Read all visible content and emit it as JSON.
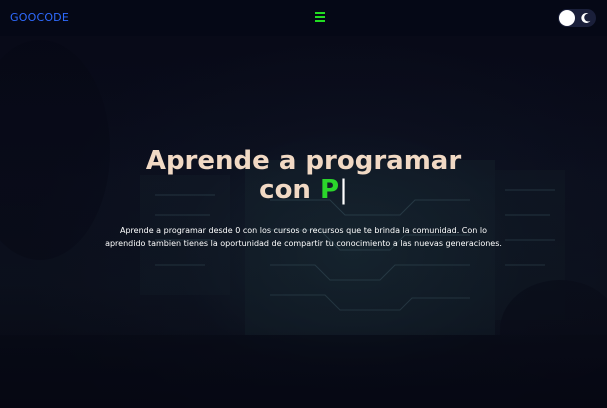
{
  "navbar": {
    "brand": "GOOCODE",
    "menu_icon": "hamburger-icon",
    "theme_toggle": {
      "knob_icon": "circle-knob-icon",
      "mode_icon": "moon-icon"
    }
  },
  "hero": {
    "title_line1": "Aprende a programar",
    "title_line2_prefix": "con",
    "title_typed": "P",
    "title_cursor": "|",
    "description": "Aprende a programar desde 0 con los cursos o recursos que te brinda la comunidad. Con lo aprendido tambien tienes la oportunidad de compartir tu conocimiento a las nuevas generaciones."
  },
  "colors": {
    "brand": "#2f6bff",
    "accent_green": "#2bd62b",
    "title": "#f1d9c4",
    "navbar_bg": "#050816"
  }
}
